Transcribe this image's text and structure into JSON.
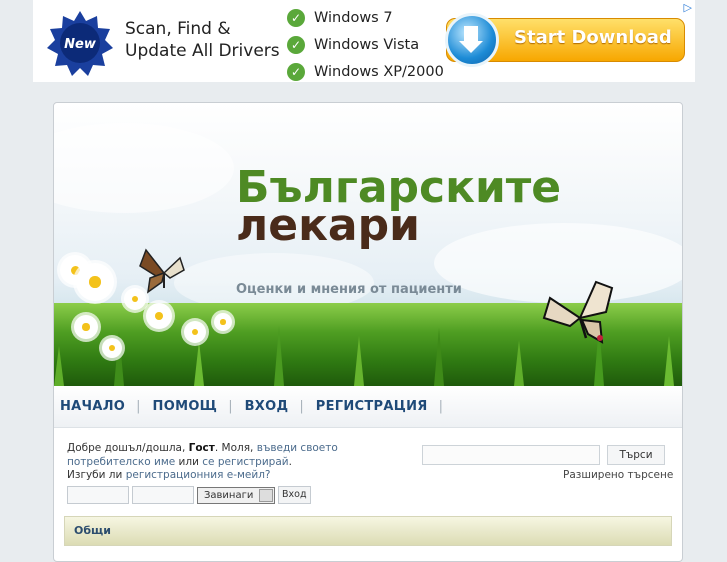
{
  "ad": {
    "headline_line1": "Scan, Find &",
    "headline_line2": "Update All Drivers",
    "badge": "New",
    "os_list": [
      "Windows 7",
      "Windows Vista",
      "Windows XP/2000"
    ],
    "cta": "Start Download",
    "colors": {
      "cta_top": "#ffe06a",
      "cta_bottom": "#f7a700",
      "check": "#5aa83a",
      "seal": "#1a3f9e"
    }
  },
  "header": {
    "title_part1": "Българските",
    "title_part2": "лекари",
    "subtitle": "Оценки и мнения от пациенти",
    "colors": {
      "title_green": "#4e8a24",
      "title_brown": "#4a2b1a"
    }
  },
  "nav": {
    "items": [
      "НАЧАЛО",
      "ПОМОЩ",
      "ВХОД",
      "РЕГИСТРАЦИЯ"
    ]
  },
  "userbar": {
    "welcome_prefix": "Добре дошъл/дошла,",
    "guest": "Гост",
    "please": ". Моля,",
    "login_link": "въведи своето потребителско име",
    "or": "или",
    "register_link": "се регистрирай",
    "lost_prefix": "Изгуби ли",
    "lost_link": "регистрационния е-мейл?",
    "session_option": "Завинаги",
    "login_button": "Вход",
    "search_button": "Търси",
    "advanced_search": "Разширено търсене"
  },
  "category": {
    "title": "Общи"
  }
}
